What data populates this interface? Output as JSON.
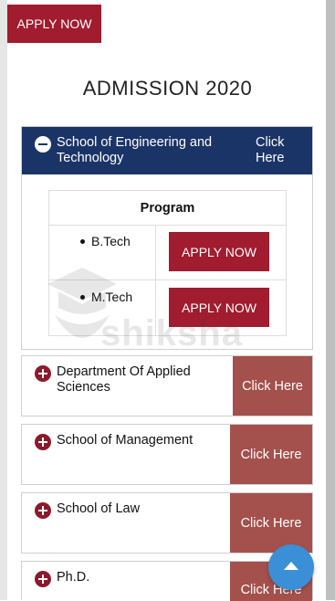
{
  "top_button": {
    "label": "APPLY NOW"
  },
  "page_title": "ADMISSION 2020",
  "expanded_section": {
    "name": "School of Engineering and Technology",
    "click_label": "Click Here",
    "table_header": "Program",
    "programs": [
      {
        "name": "B.Tech",
        "button": "APPLY NOW"
      },
      {
        "name": "M.Tech",
        "button": "APPLY NOW"
      }
    ]
  },
  "sections": [
    {
      "name": "Department Of Applied Sciences",
      "click_label": "Click Here"
    },
    {
      "name": "School of Management",
      "click_label": "Click Here"
    },
    {
      "name": "School of Law",
      "click_label": "Click Here"
    },
    {
      "name": "Ph.D.",
      "click_label": "Click Here"
    }
  ],
  "watermark": {
    "text": "shiksha"
  },
  "icons": {
    "collapse": "minus-circle-icon",
    "expand": "plus-circle-icon",
    "scroll_top": "chevron-up-icon"
  },
  "colors": {
    "primary_red": "#a01c2e",
    "header_navy": "#1b3467",
    "click_here_bg": "#a4504c",
    "scroll_button": "#3b8fd6"
  }
}
